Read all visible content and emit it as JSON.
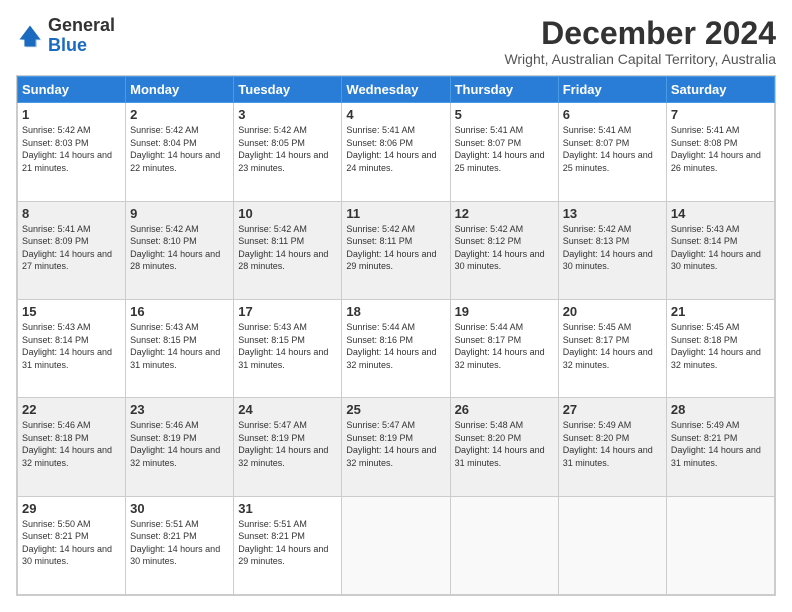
{
  "logo": {
    "general": "General",
    "blue": "Blue"
  },
  "title": "December 2024",
  "subtitle": "Wright, Australian Capital Territory, Australia",
  "weekdays": [
    "Sunday",
    "Monday",
    "Tuesday",
    "Wednesday",
    "Thursday",
    "Friday",
    "Saturday"
  ],
  "weeks": [
    [
      {
        "day": 1,
        "sunrise": "5:42 AM",
        "sunset": "8:03 PM",
        "daylight": "14 hours and 21 minutes."
      },
      {
        "day": 2,
        "sunrise": "5:42 AM",
        "sunset": "8:04 PM",
        "daylight": "14 hours and 22 minutes."
      },
      {
        "day": 3,
        "sunrise": "5:42 AM",
        "sunset": "8:05 PM",
        "daylight": "14 hours and 23 minutes."
      },
      {
        "day": 4,
        "sunrise": "5:41 AM",
        "sunset": "8:06 PM",
        "daylight": "14 hours and 24 minutes."
      },
      {
        "day": 5,
        "sunrise": "5:41 AM",
        "sunset": "8:07 PM",
        "daylight": "14 hours and 25 minutes."
      },
      {
        "day": 6,
        "sunrise": "5:41 AM",
        "sunset": "8:07 PM",
        "daylight": "14 hours and 25 minutes."
      },
      {
        "day": 7,
        "sunrise": "5:41 AM",
        "sunset": "8:08 PM",
        "daylight": "14 hours and 26 minutes."
      }
    ],
    [
      {
        "day": 8,
        "sunrise": "5:41 AM",
        "sunset": "8:09 PM",
        "daylight": "14 hours and 27 minutes."
      },
      {
        "day": 9,
        "sunrise": "5:42 AM",
        "sunset": "8:10 PM",
        "daylight": "14 hours and 28 minutes."
      },
      {
        "day": 10,
        "sunrise": "5:42 AM",
        "sunset": "8:11 PM",
        "daylight": "14 hours and 28 minutes."
      },
      {
        "day": 11,
        "sunrise": "5:42 AM",
        "sunset": "8:11 PM",
        "daylight": "14 hours and 29 minutes."
      },
      {
        "day": 12,
        "sunrise": "5:42 AM",
        "sunset": "8:12 PM",
        "daylight": "14 hours and 30 minutes."
      },
      {
        "day": 13,
        "sunrise": "5:42 AM",
        "sunset": "8:13 PM",
        "daylight": "14 hours and 30 minutes."
      },
      {
        "day": 14,
        "sunrise": "5:43 AM",
        "sunset": "8:14 PM",
        "daylight": "14 hours and 30 minutes."
      }
    ],
    [
      {
        "day": 15,
        "sunrise": "5:43 AM",
        "sunset": "8:14 PM",
        "daylight": "14 hours and 31 minutes."
      },
      {
        "day": 16,
        "sunrise": "5:43 AM",
        "sunset": "8:15 PM",
        "daylight": "14 hours and 31 minutes."
      },
      {
        "day": 17,
        "sunrise": "5:43 AM",
        "sunset": "8:15 PM",
        "daylight": "14 hours and 31 minutes."
      },
      {
        "day": 18,
        "sunrise": "5:44 AM",
        "sunset": "8:16 PM",
        "daylight": "14 hours and 32 minutes."
      },
      {
        "day": 19,
        "sunrise": "5:44 AM",
        "sunset": "8:17 PM",
        "daylight": "14 hours and 32 minutes."
      },
      {
        "day": 20,
        "sunrise": "5:45 AM",
        "sunset": "8:17 PM",
        "daylight": "14 hours and 32 minutes."
      },
      {
        "day": 21,
        "sunrise": "5:45 AM",
        "sunset": "8:18 PM",
        "daylight": "14 hours and 32 minutes."
      }
    ],
    [
      {
        "day": 22,
        "sunrise": "5:46 AM",
        "sunset": "8:18 PM",
        "daylight": "14 hours and 32 minutes."
      },
      {
        "day": 23,
        "sunrise": "5:46 AM",
        "sunset": "8:19 PM",
        "daylight": "14 hours and 32 minutes."
      },
      {
        "day": 24,
        "sunrise": "5:47 AM",
        "sunset": "8:19 PM",
        "daylight": "14 hours and 32 minutes."
      },
      {
        "day": 25,
        "sunrise": "5:47 AM",
        "sunset": "8:19 PM",
        "daylight": "14 hours and 32 minutes."
      },
      {
        "day": 26,
        "sunrise": "5:48 AM",
        "sunset": "8:20 PM",
        "daylight": "14 hours and 31 minutes."
      },
      {
        "day": 27,
        "sunrise": "5:49 AM",
        "sunset": "8:20 PM",
        "daylight": "14 hours and 31 minutes."
      },
      {
        "day": 28,
        "sunrise": "5:49 AM",
        "sunset": "8:21 PM",
        "daylight": "14 hours and 31 minutes."
      }
    ],
    [
      {
        "day": 29,
        "sunrise": "5:50 AM",
        "sunset": "8:21 PM",
        "daylight": "14 hours and 30 minutes."
      },
      {
        "day": 30,
        "sunrise": "5:51 AM",
        "sunset": "8:21 PM",
        "daylight": "14 hours and 30 minutes."
      },
      {
        "day": 31,
        "sunrise": "5:51 AM",
        "sunset": "8:21 PM",
        "daylight": "14 hours and 29 minutes."
      },
      null,
      null,
      null,
      null
    ]
  ]
}
